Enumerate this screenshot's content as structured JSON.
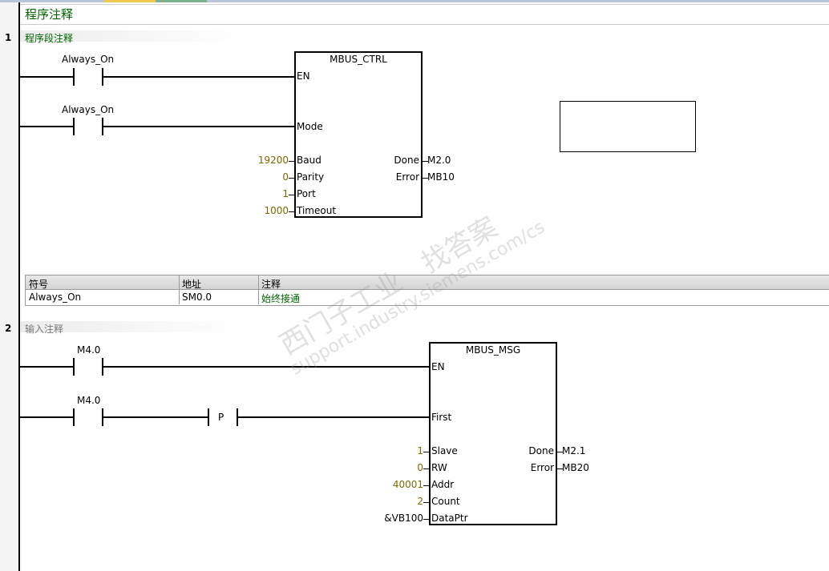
{
  "program": {
    "title": "程序注释"
  },
  "network1": {
    "number": "1",
    "comment": "程序段注释",
    "contacts": [
      "Always_On",
      "Always_On"
    ],
    "block": {
      "name": "MBUS_CTRL",
      "inputs": [
        "EN",
        "Mode",
        "Baud",
        "Parity",
        "Port",
        "Timeout"
      ],
      "params": [
        "19200",
        "0",
        "1",
        "1000"
      ],
      "outputs": [
        "Done",
        "Error"
      ],
      "output_values": [
        "M2.0",
        "MB10"
      ]
    },
    "symbol_table": {
      "headers": [
        "符号",
        "地址",
        "注释"
      ],
      "rows": [
        {
          "symbol": "Always_On",
          "address": "SM0.0",
          "comment": "始终接通"
        }
      ]
    }
  },
  "network2": {
    "number": "2",
    "comment": "输入注释",
    "contacts": [
      "M4.0",
      "M4.0"
    ],
    "edge_label": "P",
    "block": {
      "name": "MBUS_MSG",
      "inputs": [
        "EN",
        "First",
        "Slave",
        "RW",
        "Addr",
        "Count",
        "DataPtr"
      ],
      "params": [
        "1",
        "0",
        "40001",
        "2",
        "&VB100"
      ],
      "outputs": [
        "Done",
        "Error"
      ],
      "output_values": [
        "M2.1",
        "MB20"
      ]
    }
  },
  "watermark": {
    "line1": "西门子工业　找答案",
    "line2": "support.industry.siemens.com/cs"
  },
  "colors": {
    "comment_green": "#006400",
    "param_olive": "#7a6a00"
  }
}
